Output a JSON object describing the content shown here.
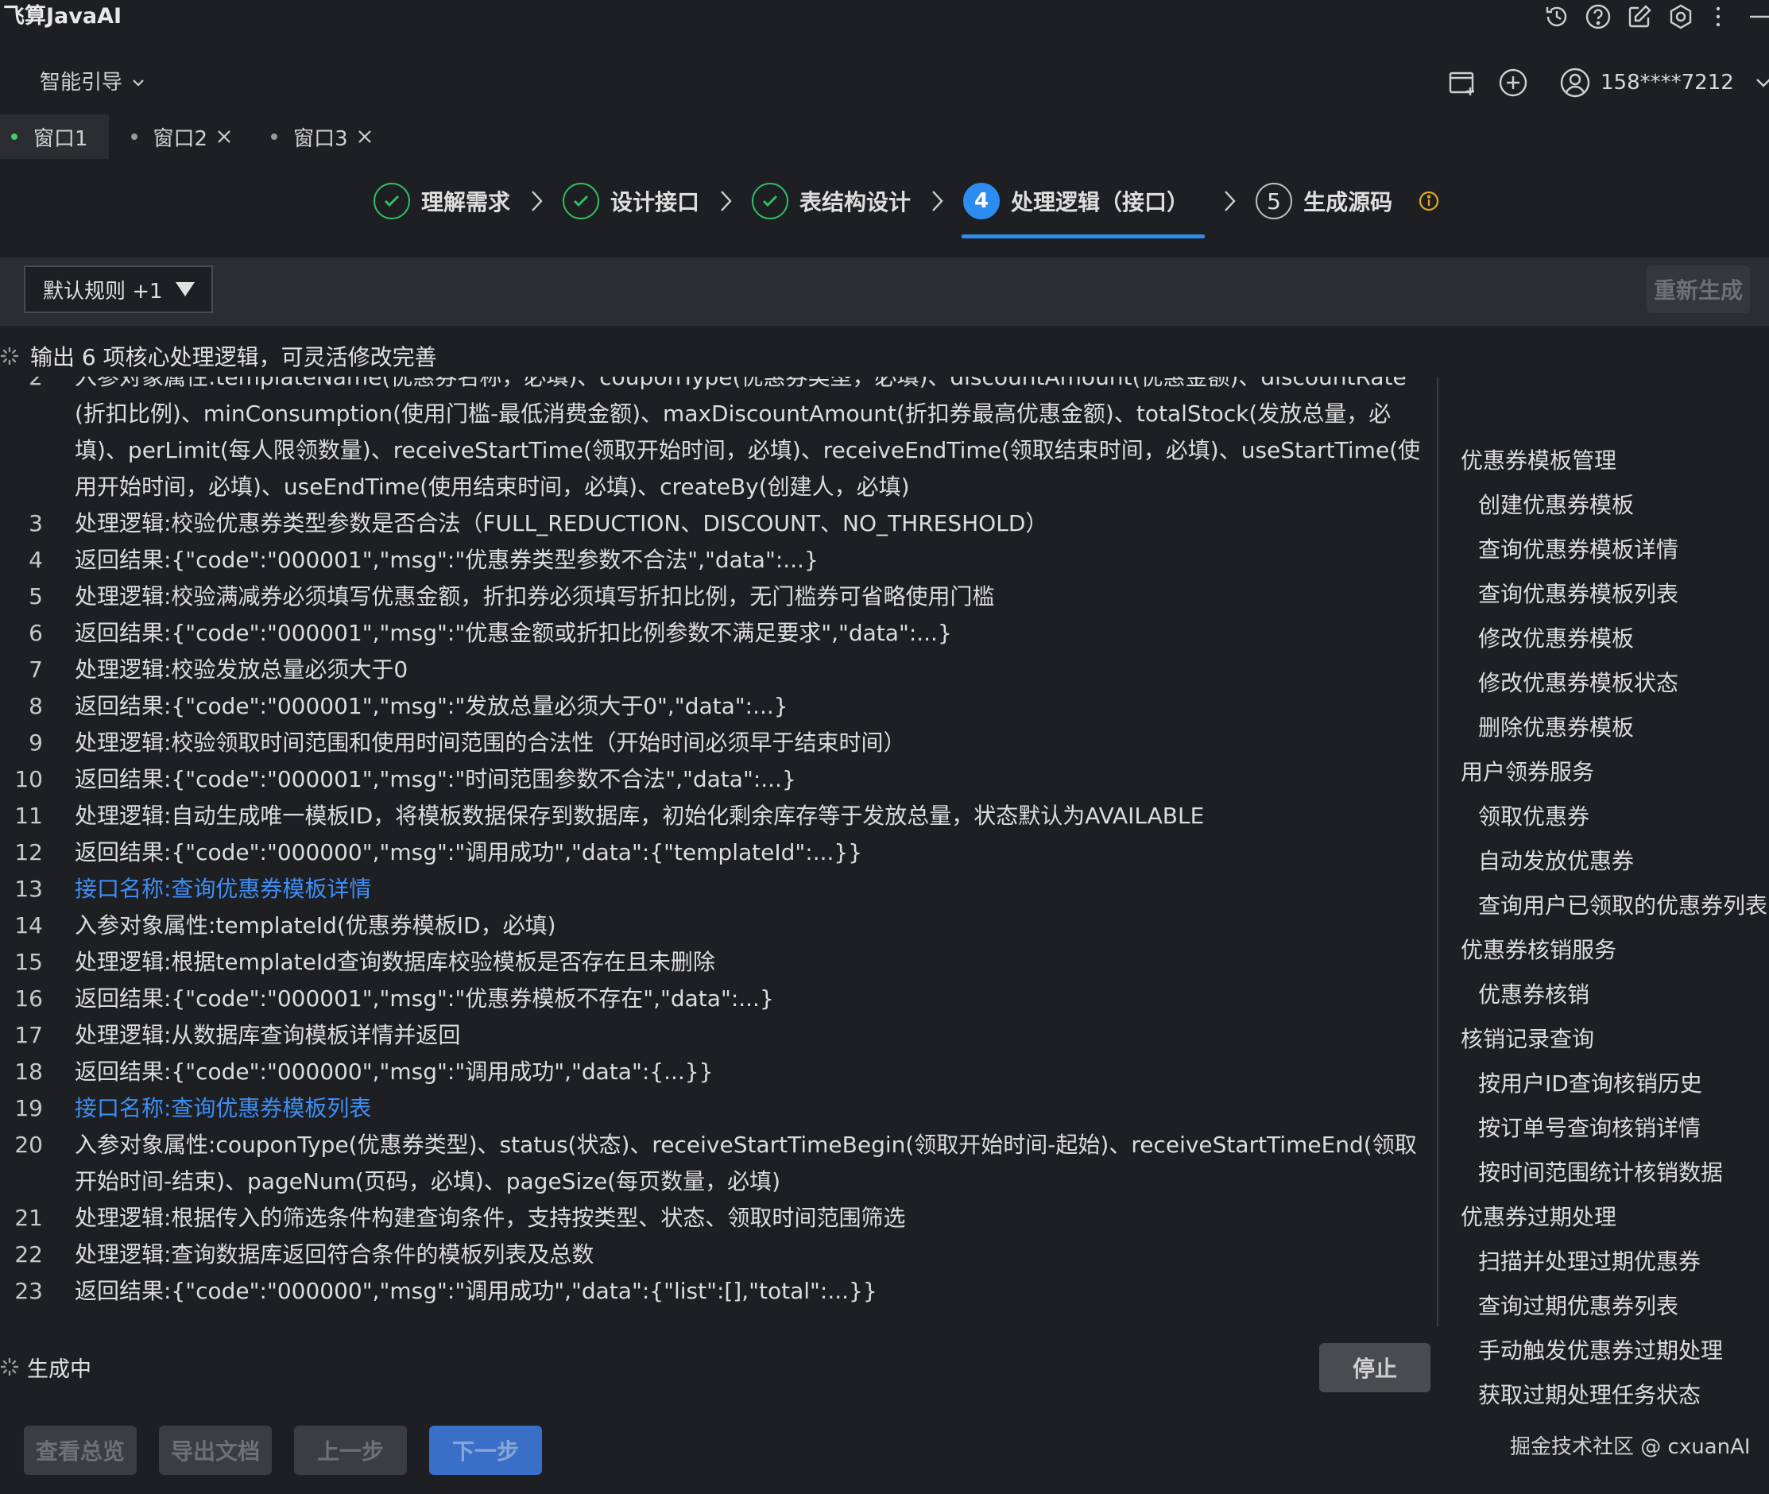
{
  "app": {
    "title": "飞算JavaAI"
  },
  "header": {
    "guide_label": "智能引导",
    "user": "158****7212"
  },
  "tabs": [
    {
      "label": "窗口1",
      "active": true
    },
    {
      "label": "窗口2",
      "active": false
    },
    {
      "label": "窗口3",
      "active": false
    }
  ],
  "steps": [
    {
      "index": "✓",
      "label": "理解需求",
      "state": "done"
    },
    {
      "index": "✓",
      "label": "设计接口",
      "state": "done"
    },
    {
      "index": "✓",
      "label": "表结构设计",
      "state": "done"
    },
    {
      "index": "4",
      "label": "处理逻辑（接口）",
      "state": "active"
    },
    {
      "index": "5",
      "label": "生成源码",
      "state": "pending"
    }
  ],
  "toolbar": {
    "rule_select": "默认规则 +1",
    "regenerate": "重新生成"
  },
  "status": {
    "output_message": "输出 6 项核心处理逻辑，可灵活修改完善",
    "generating": "生成中"
  },
  "editor": {
    "lines": [
      {
        "n": "2",
        "text": "入参对象属性:templateName(优惠券名称，必填)、couponType(优惠券类型，必填)、discountAmount(优惠金额)、discountRate(折扣比例)、minConsumption(使用门槛-最低消费金额)、maxDiscountAmount(折扣券最高优惠金额)、totalStock(发放总量，必填)、perLimit(每人限领数量)、receiveStartTime(领取开始时间，必填)、receiveEndTime(领取结束时间，必填)、useStartTime(使用开始时间，必填)、useEndTime(使用结束时间，必填)、createBy(创建人，必填)",
        "link": false
      },
      {
        "n": "3",
        "text": "处理逻辑:校验优惠券类型参数是否合法（FULL_REDUCTION、DISCOUNT、NO_THRESHOLD）",
        "link": false
      },
      {
        "n": "4",
        "text": "返回结果:{\"code\":\"000001\",\"msg\":\"优惠券类型参数不合法\",\"data\":...}",
        "link": false
      },
      {
        "n": "5",
        "text": "处理逻辑:校验满减券必须填写优惠金额，折扣券必须填写折扣比例，无门槛券可省略使用门槛",
        "link": false
      },
      {
        "n": "6",
        "text": "返回结果:{\"code\":\"000001\",\"msg\":\"优惠金额或折扣比例参数不满足要求\",\"data\":...}",
        "link": false
      },
      {
        "n": "7",
        "text": "处理逻辑:校验发放总量必须大于0",
        "link": false
      },
      {
        "n": "8",
        "text": "返回结果:{\"code\":\"000001\",\"msg\":\"发放总量必须大于0\",\"data\":...}",
        "link": false
      },
      {
        "n": "9",
        "text": "处理逻辑:校验领取时间范围和使用时间范围的合法性（开始时间必须早于结束时间）",
        "link": false
      },
      {
        "n": "10",
        "text": "返回结果:{\"code\":\"000001\",\"msg\":\"时间范围参数不合法\",\"data\":...}",
        "link": false
      },
      {
        "n": "11",
        "text": "处理逻辑:自动生成唯一模板ID，将模板数据保存到数据库，初始化剩余库存等于发放总量，状态默认为AVAILABLE",
        "link": false
      },
      {
        "n": "12",
        "text": "返回结果:{\"code\":\"000000\",\"msg\":\"调用成功\",\"data\":{\"templateId\":...}}",
        "link": false
      },
      {
        "n": "13",
        "text": "接口名称:查询优惠券模板详情",
        "link": true
      },
      {
        "n": "14",
        "text": "入参对象属性:templateId(优惠券模板ID，必填)",
        "link": false
      },
      {
        "n": "15",
        "text": "处理逻辑:根据templateId查询数据库校验模板是否存在且未删除",
        "link": false
      },
      {
        "n": "16",
        "text": "返回结果:{\"code\":\"000001\",\"msg\":\"优惠券模板不存在\",\"data\":...}",
        "link": false
      },
      {
        "n": "17",
        "text": "处理逻辑:从数据库查询模板详情并返回",
        "link": false
      },
      {
        "n": "18",
        "text": "返回结果:{\"code\":\"000000\",\"msg\":\"调用成功\",\"data\":{...}}",
        "link": false
      },
      {
        "n": "19",
        "text": "接口名称:查询优惠券模板列表",
        "link": true
      },
      {
        "n": "20",
        "text": "入参对象属性:couponType(优惠券类型)、status(状态)、receiveStartTimeBegin(领取开始时间-起始)、receiveStartTimeEnd(领取开始时间-结束)、pageNum(页码，必填)、pageSize(每页数量，必填)",
        "link": false
      },
      {
        "n": "21",
        "text": "处理逻辑:根据传入的筛选条件构建查询条件，支持按类型、状态、领取时间范围筛选",
        "link": false
      },
      {
        "n": "22",
        "text": "处理逻辑:查询数据库返回符合条件的模板列表及总数",
        "link": false
      },
      {
        "n": "23",
        "text": "返回结果:{\"code\":\"000000\",\"msg\":\"调用成功\",\"data\":{\"list\":[],\"total\":...}}",
        "link": false
      }
    ]
  },
  "outline": [
    {
      "label": "优惠券模板管理",
      "level": 0
    },
    {
      "label": "创建优惠券模板",
      "level": 1
    },
    {
      "label": "查询优惠券模板详情",
      "level": 1
    },
    {
      "label": "查询优惠券模板列表",
      "level": 1
    },
    {
      "label": "修改优惠券模板",
      "level": 1
    },
    {
      "label": "修改优惠券模板状态",
      "level": 1
    },
    {
      "label": "删除优惠券模板",
      "level": 1
    },
    {
      "label": "用户领券服务",
      "level": 0
    },
    {
      "label": "领取优惠券",
      "level": 1
    },
    {
      "label": "自动发放优惠券",
      "level": 1
    },
    {
      "label": "查询用户已领取的优惠券列表",
      "level": 1
    },
    {
      "label": "优惠券核销服务",
      "level": 0
    },
    {
      "label": "优惠券核销",
      "level": 1
    },
    {
      "label": "核销记录查询",
      "level": 0
    },
    {
      "label": "按用户ID查询核销历史",
      "level": 1
    },
    {
      "label": "按订单号查询核销详情",
      "level": 1
    },
    {
      "label": "按时间范围统计核销数据",
      "level": 1
    },
    {
      "label": "优惠券过期处理",
      "level": 0
    },
    {
      "label": "扫描并处理过期优惠券",
      "level": 1
    },
    {
      "label": "查询过期优惠券列表",
      "level": 1
    },
    {
      "label": "手动触发优惠券过期处理",
      "level": 1
    },
    {
      "label": "获取过期处理任务状态",
      "level": 1
    }
  ],
  "buttons": {
    "stop": "停止",
    "overview": "查看总览",
    "export": "导出文档",
    "prev": "上一步",
    "next": "下一步"
  },
  "watermark": "掘金技术社区 @ cxuanAI",
  "colors": {
    "background": "#1e1f22",
    "accent": "#2d8cf0",
    "success": "#2fbf63",
    "link": "#3d8ff7",
    "warning": "#e6a817"
  }
}
